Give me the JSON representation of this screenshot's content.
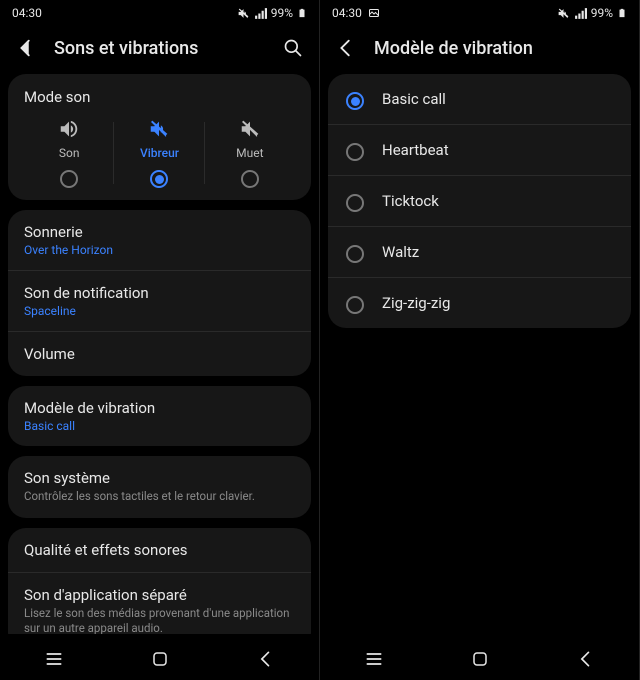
{
  "left": {
    "status": {
      "time": "04:30",
      "battery": "99%"
    },
    "header": {
      "title": "Sons et vibrations"
    },
    "mode_card": {
      "title": "Mode son",
      "col_son": {
        "label": "Son"
      },
      "col_vibreur": {
        "label": "Vibreur"
      },
      "col_muet": {
        "label": "Muet"
      },
      "selected": "vibreur"
    },
    "group1": {
      "ringtone": {
        "title": "Sonnerie",
        "sub": "Over the Horizon"
      },
      "notification": {
        "title": "Son de notification",
        "sub": "Spaceline"
      },
      "volume": {
        "title": "Volume"
      }
    },
    "group2": {
      "vibpattern": {
        "title": "Modèle de vibration",
        "sub": "Basic call"
      }
    },
    "group3": {
      "system": {
        "title": "Son système",
        "desc": "Contrôlez les sons tactiles et le retour clavier."
      }
    },
    "group4": {
      "quality": {
        "title": "Qualité et effets sonores"
      },
      "appsound": {
        "title": "Son d'application séparé",
        "desc": "Lisez le son des médias provenant d'une application sur un autre appareil audio."
      }
    }
  },
  "right": {
    "status": {
      "time": "04:30",
      "battery": "99%"
    },
    "header": {
      "title": "Modèle de vibration"
    },
    "options": {
      "o0": "Basic call",
      "o1": "Heartbeat",
      "o2": "Ticktock",
      "o3": "Waltz",
      "o4": "Zig-zig-zig"
    },
    "selected_index": 0
  }
}
